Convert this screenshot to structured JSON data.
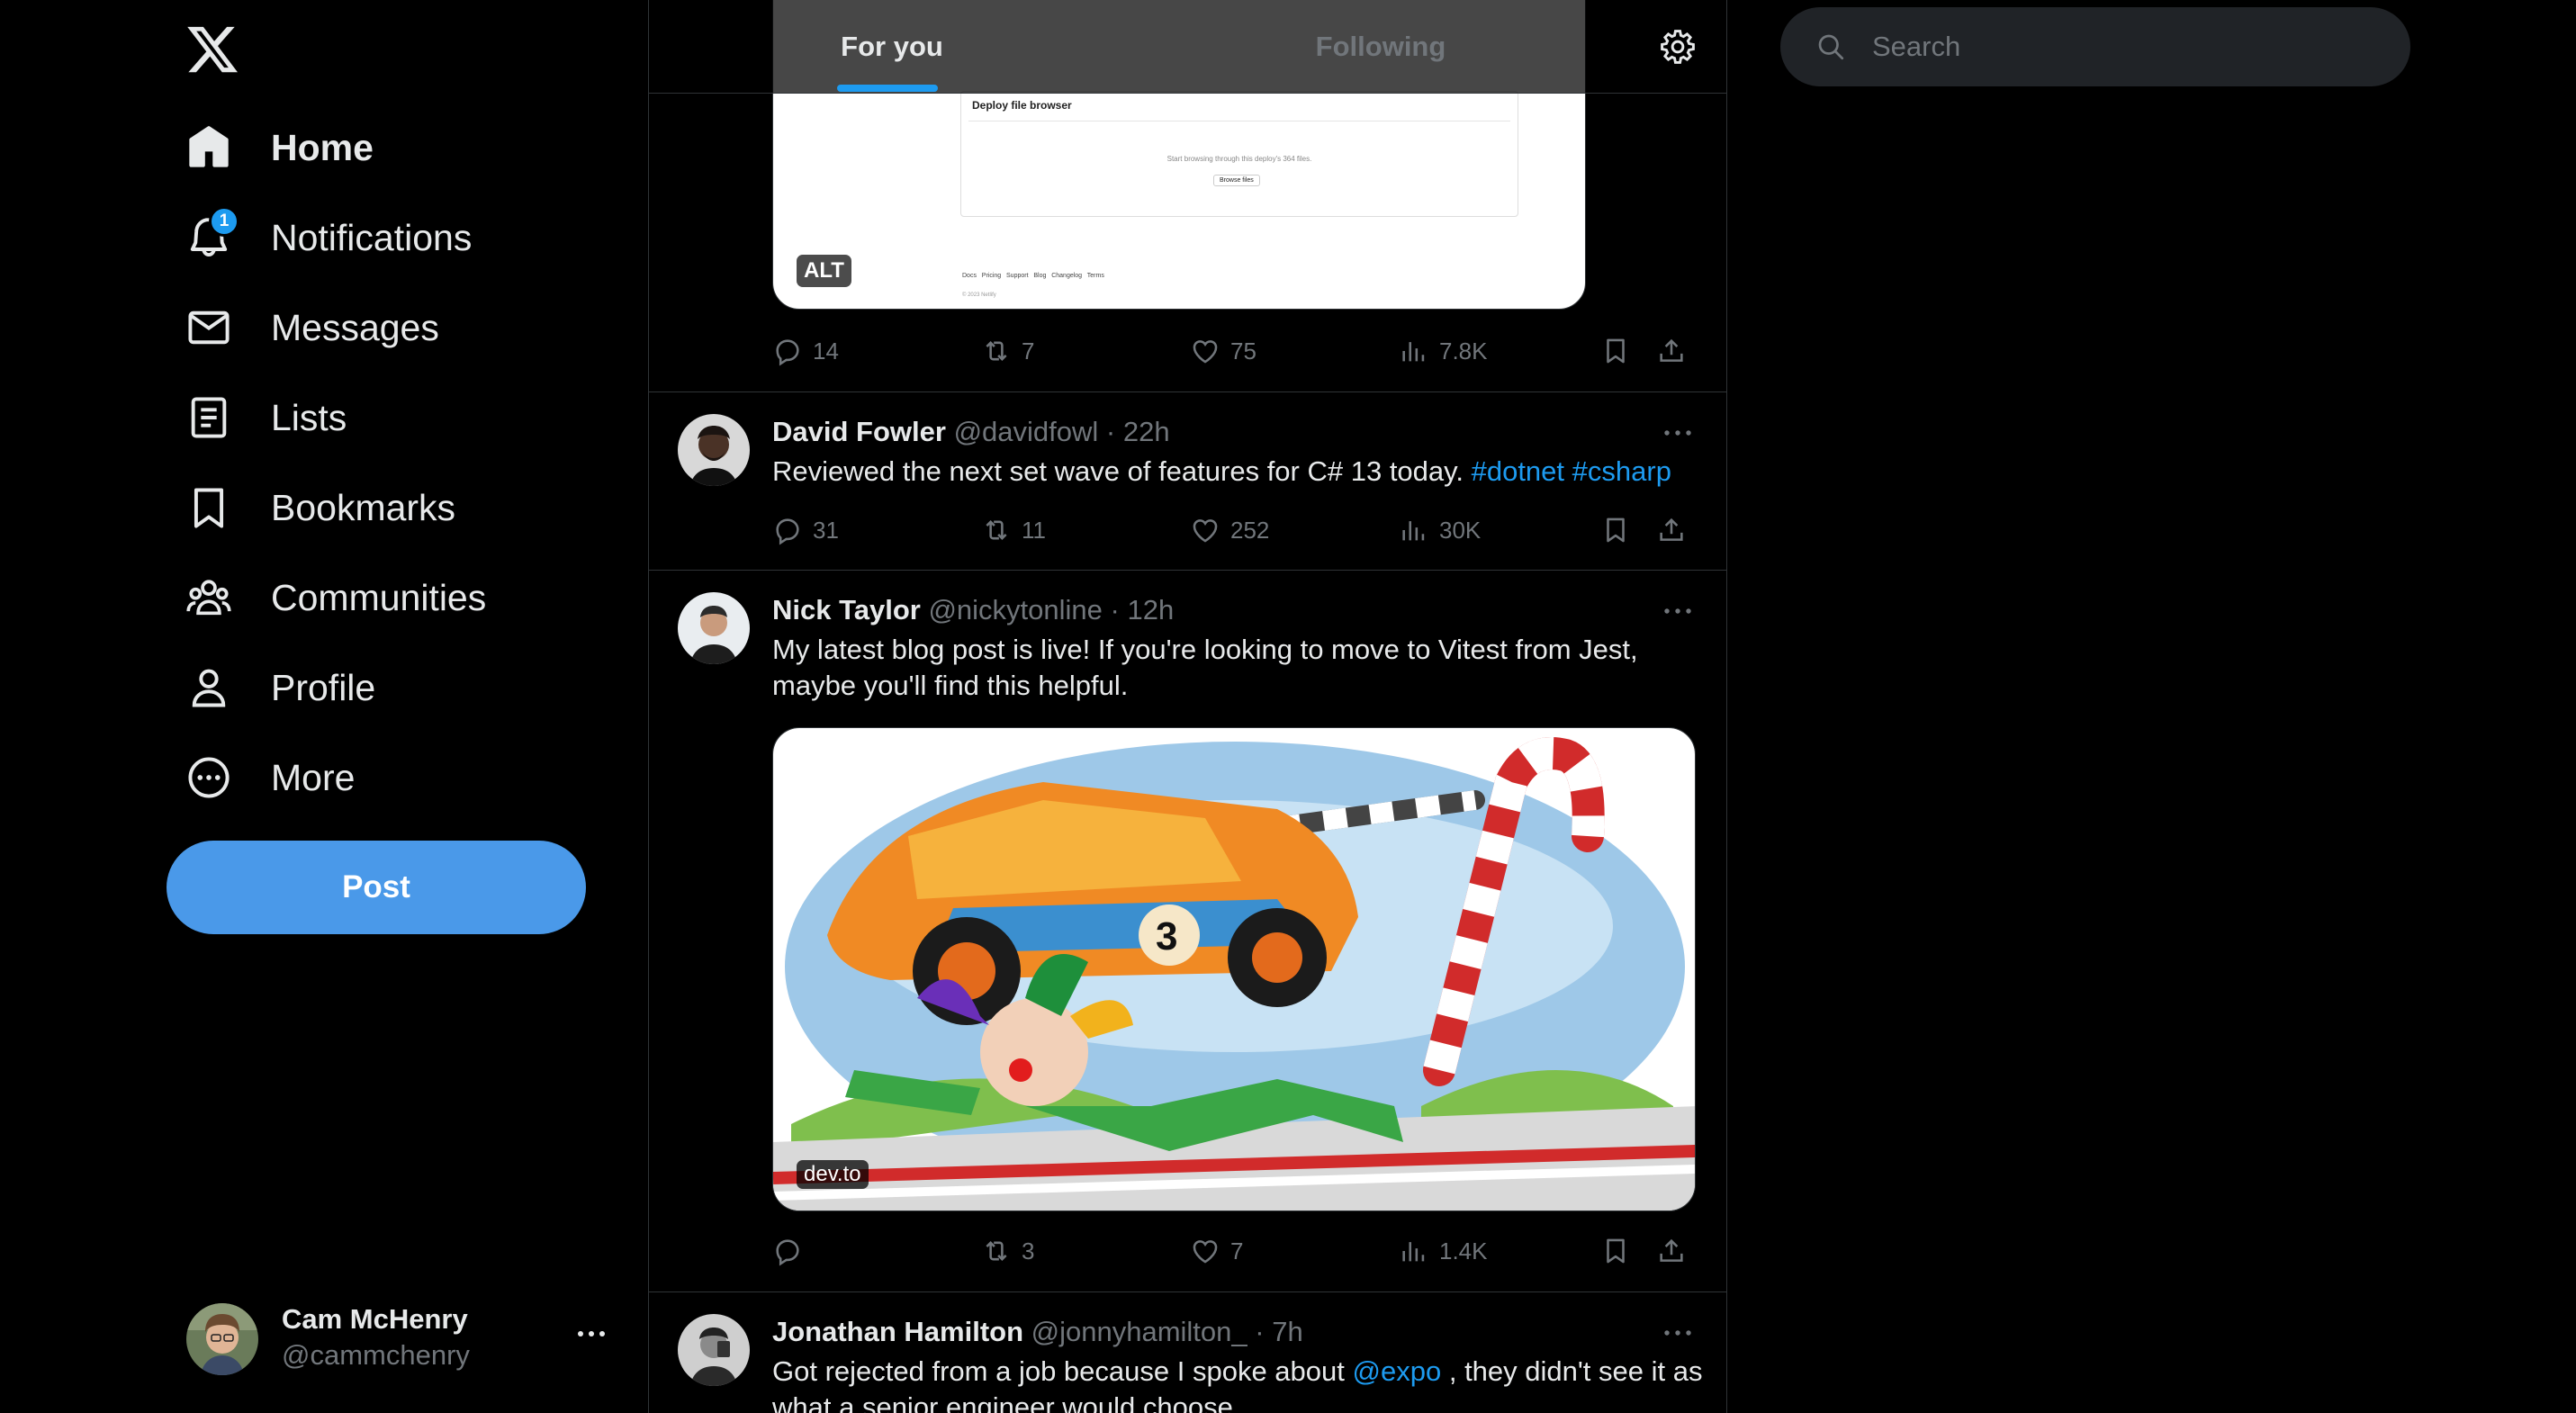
{
  "sidebar": {
    "items": [
      {
        "label": "Home",
        "icon": "home-icon"
      },
      {
        "label": "Notifications",
        "icon": "bell-icon",
        "badge": "1"
      },
      {
        "label": "Messages",
        "icon": "envelope-icon"
      },
      {
        "label": "Lists",
        "icon": "list-icon"
      },
      {
        "label": "Bookmarks",
        "icon": "bookmark-icon"
      },
      {
        "label": "Communities",
        "icon": "communities-icon"
      },
      {
        "label": "Profile",
        "icon": "person-icon"
      },
      {
        "label": "More",
        "icon": "more-circle-icon"
      }
    ],
    "post_label": "Post",
    "account": {
      "name": "Cam McHenry",
      "handle": "@cammchenry"
    }
  },
  "feed": {
    "tabs": [
      {
        "label": "For you"
      },
      {
        "label": "Following"
      }
    ],
    "tweets": [
      {
        "media": {
          "title": "Deploy file browser",
          "body": "Start browsing through this deploy's 364 files.",
          "button": "Browse files",
          "footer_links": "Docs   Pricing   Support   Blog   Changelog   Terms",
          "copyright": "© 2023 Netlify",
          "alt": "ALT"
        },
        "stats": {
          "replies": "14",
          "reposts": "7",
          "likes": "75",
          "views": "7.8K"
        }
      },
      {
        "name": "David Fowler",
        "handle": "@davidfowl",
        "time": "· 22h",
        "text": "Reviewed the next set wave of features for C# 13 today.",
        "tags": [
          "#dotnet",
          "#csharp"
        ],
        "stats": {
          "replies": "31",
          "reposts": "11",
          "likes": "252",
          "views": "30K"
        }
      },
      {
        "name": "Nick Taylor",
        "handle": "@nickytonline",
        "time": "· 12h",
        "text": "My latest blog post is live! If you're looking to move to Vitest from Jest, maybe you'll find this helpful.",
        "media": {
          "source": "dev.to"
        },
        "stats": {
          "replies": "",
          "reposts": "3",
          "likes": "7",
          "views": "1.4K"
        }
      },
      {
        "name": "Jonathan Hamilton",
        "handle": "@jonnyhamilton_",
        "time": "· 7h",
        "text_before": "Got rejected from a job because I spoke about",
        "mention": "@expo",
        "text_after": ", they didn't see it as what a senior engineer would choose"
      }
    ]
  },
  "search": {
    "placeholder": "Search"
  },
  "colors": {
    "accent": "#1d9bf0",
    "post_button": "#4a99e9",
    "background": "#000000",
    "muted": "#71767b"
  }
}
